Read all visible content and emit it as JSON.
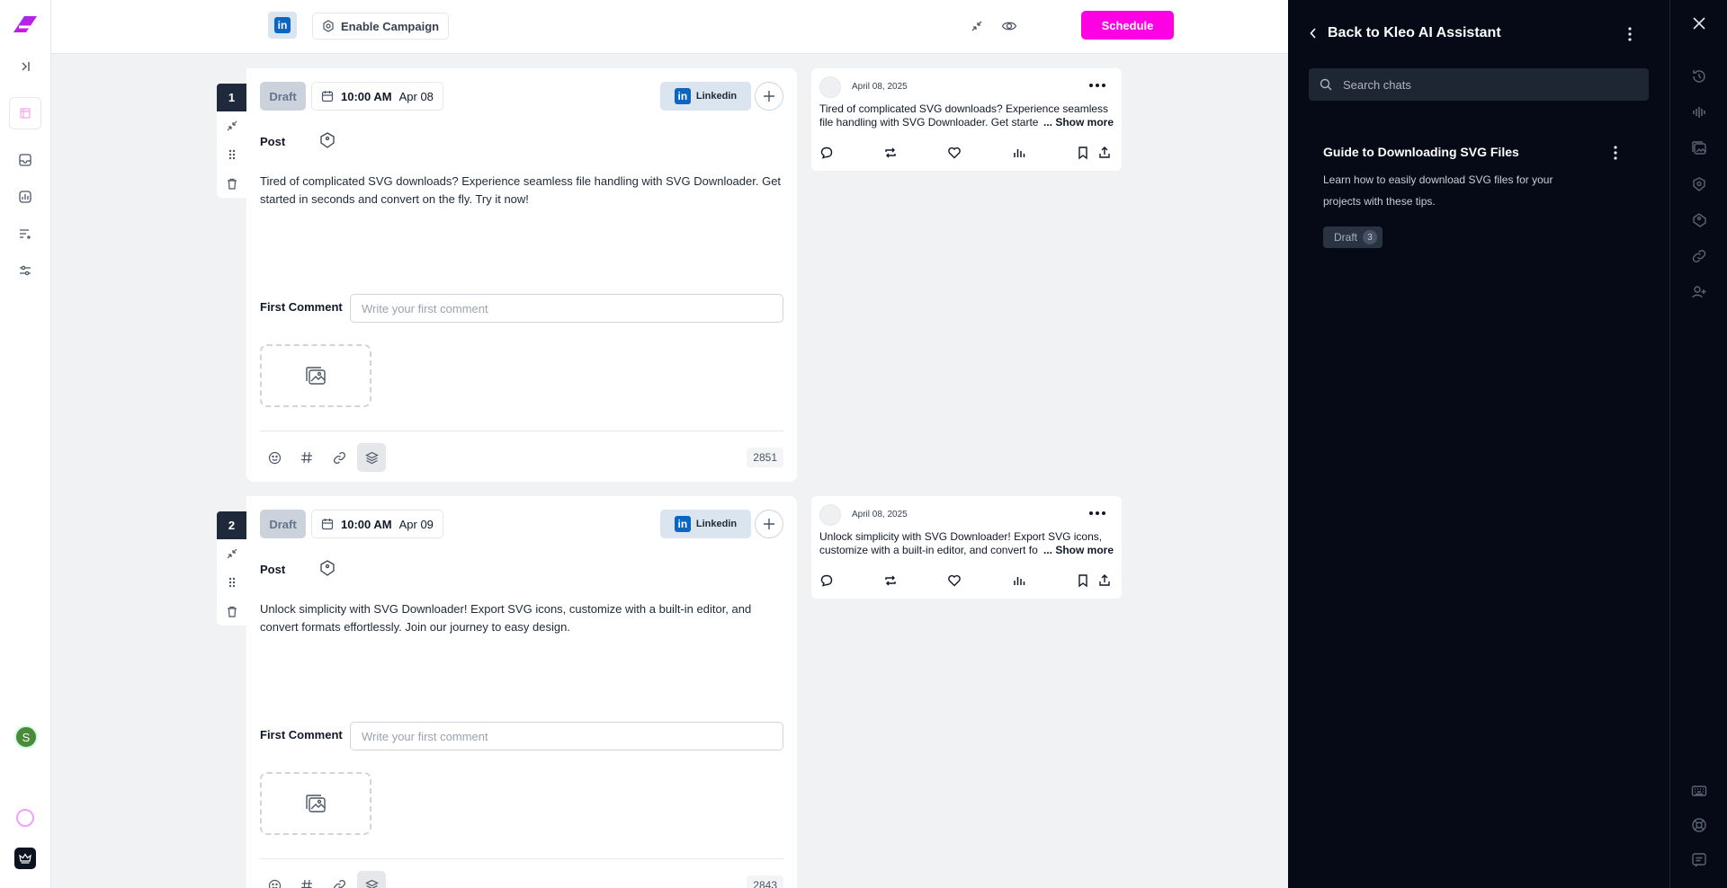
{
  "topbar": {
    "enable_campaign_label": "Enable Campaign",
    "schedule_label": "Schedule"
  },
  "posts": [
    {
      "index": "1",
      "status": "Draft",
      "time": "10:00 AM",
      "date": "Apr 08",
      "platform": "Linkedin",
      "post_label": "Post",
      "body": "Tired of complicated SVG downloads? Experience seamless file handling with SVG Downloader. Get started in seconds and convert on the fly. Try it now!",
      "first_comment_label": "First Comment",
      "first_comment_placeholder": "Write your first comment",
      "char_count": "2851",
      "preview": {
        "date": "April 08, 2025",
        "text": "Tired of complicated SVG downloads? Experience seamless file handling with SVG Downloader. Get started in seconds",
        "show_more": "... Show more"
      }
    },
    {
      "index": "2",
      "status": "Draft",
      "time": "10:00 AM",
      "date": "Apr 09",
      "platform": "Linkedin",
      "post_label": "Post",
      "body": "Unlock simplicity with SVG Downloader! Export SVG icons, customize with a built-in editor, and convert formats effortlessly. Join our journey to easy design.",
      "first_comment_label": "First Comment",
      "first_comment_placeholder": "Write your first comment",
      "char_count": "2843",
      "preview": {
        "date": "April 08, 2025",
        "text": "Unlock simplicity with SVG Downloader! Export SVG icons, customize with a built-in editor, and convert formats",
        "show_more": "... Show more"
      }
    }
  ],
  "panel": {
    "back_label": "Back to Kleo AI Assistant",
    "search_placeholder": "Search chats",
    "chats": [
      {
        "title": "Guide to Downloading SVG Files",
        "description": "Learn how to easily download SVG files for your projects with these tips.",
        "badge": "Draft",
        "badge_count": "3"
      }
    ]
  },
  "user": {
    "avatar_initial": "S"
  },
  "colors": {
    "accent": "#ff00e5",
    "linkedin": "#0a66c2",
    "panel_bg": "#050a16",
    "num_bg": "#1e293b"
  }
}
